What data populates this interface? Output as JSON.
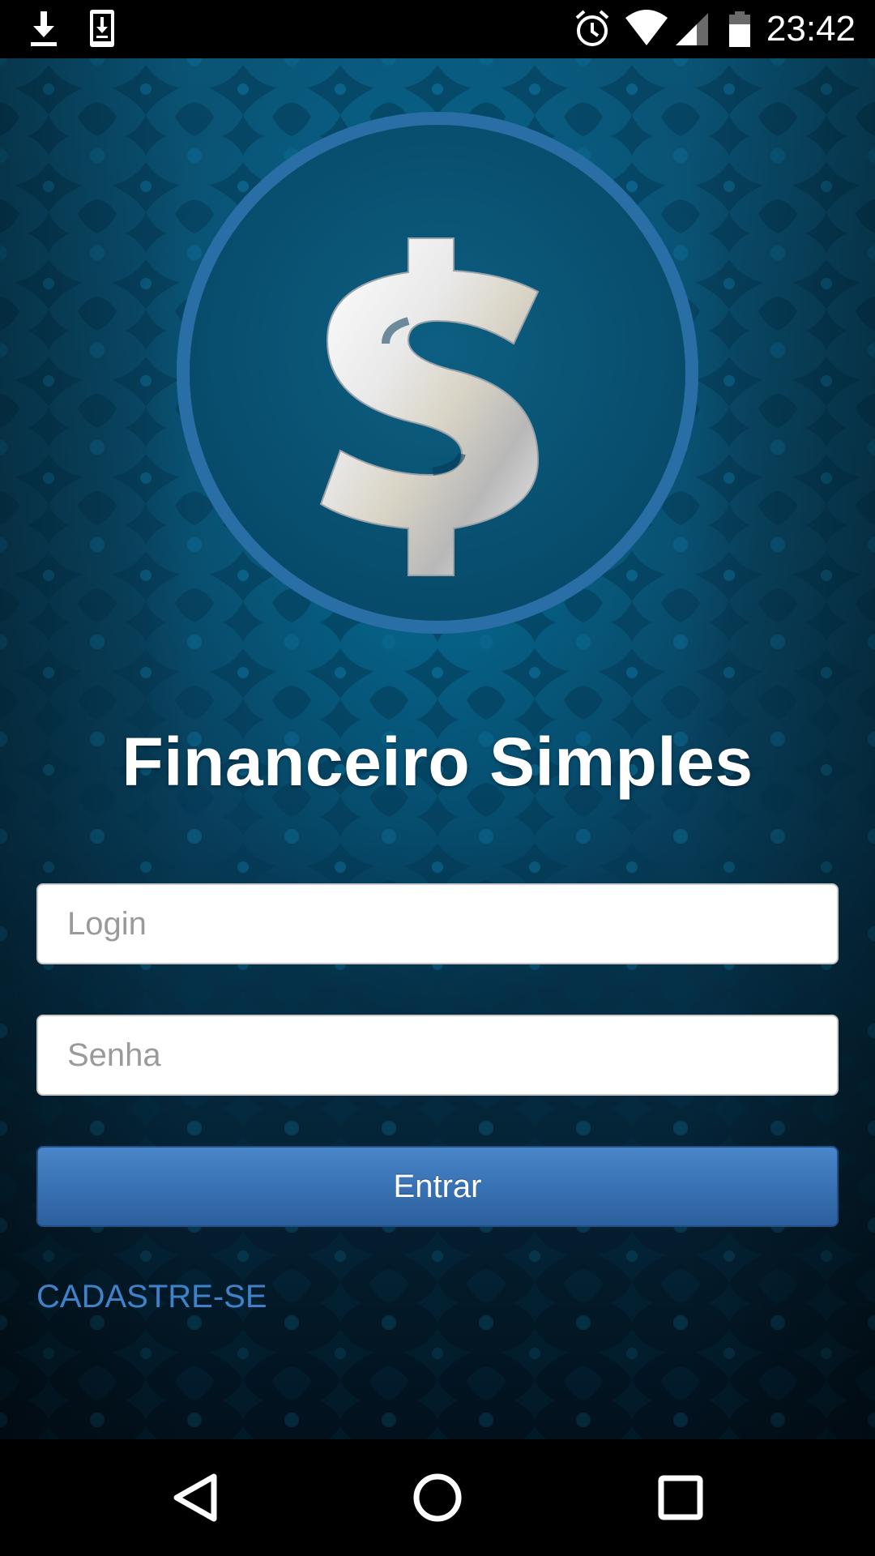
{
  "status_bar": {
    "time": "23:42",
    "icons": [
      "download-icon",
      "download-box-icon",
      "alarm-icon",
      "wifi-icon",
      "signal-icon",
      "battery-icon"
    ]
  },
  "app": {
    "title": "Financeiro Simples",
    "logo_icon": "dollar-sign-icon"
  },
  "form": {
    "login_placeholder": "Login",
    "password_placeholder": "Senha",
    "submit_label": "Entrar",
    "signup_label": "CADASTRE-SE"
  },
  "nav_bar": {
    "icons": [
      "back-icon",
      "home-icon",
      "recents-icon"
    ]
  },
  "colors": {
    "background_top": "#0a5476",
    "background_bottom": "#031e33",
    "button": "#3a74b6",
    "link": "#3f82c9",
    "logo_circle": "#0b5575",
    "logo_ring": "#2a6ea6"
  }
}
